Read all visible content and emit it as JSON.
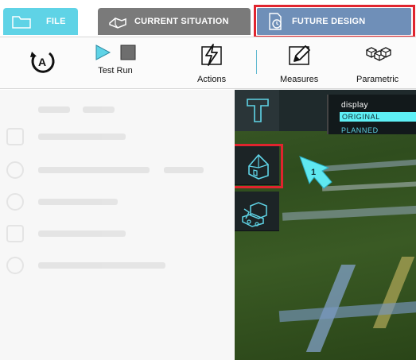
{
  "tabs": {
    "file": "FILE",
    "current": "CURRENT SITUATION",
    "future": "FUTURE DESIGN"
  },
  "toolbar": {
    "test_run": "Test Run",
    "actions": "Actions",
    "measures": "Measures",
    "parametric": "Parametric"
  },
  "display": {
    "title": "display",
    "original": "ORIGINAL",
    "planned": "PLANNED"
  },
  "marker": {
    "number": "1"
  },
  "colors": {
    "tab_file": "#5fd3e6",
    "tab_current": "#7a7a7a",
    "tab_future": "#6f8fb8",
    "highlight": "#e0242e",
    "accent_cyan": "#5ef0f6"
  }
}
